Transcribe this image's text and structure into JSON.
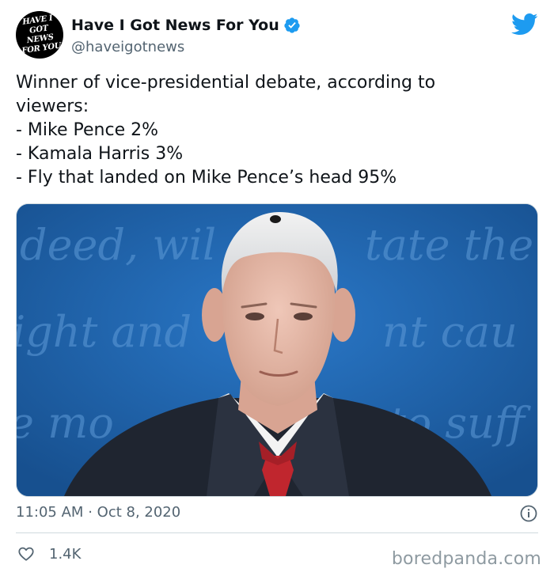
{
  "account": {
    "avatar_text_line1": "HAVE I GOT NEWS",
    "avatar_text_line2": "FOR YOU",
    "display_name": "Have I Got News For You",
    "handle": "@haveigotnews",
    "verified": true
  },
  "tweet": {
    "lines": [
      "Winner of vice-presidential debate, according to",
      "viewers:",
      "- Mike Pence 2%",
      "- Kamala Harris 3%",
      "- Fly that landed on Mike Pence’s head 95%"
    ],
    "time": "11:05 AM",
    "separator": "·",
    "date": "Oct 8, 2020",
    "likes": "1.4K"
  },
  "media": {
    "backdrop_words": [
      "deed, wil",
      "tate the",
      "ight and",
      "nt cau",
      "e mo",
      "to suff"
    ]
  },
  "watermark": "boredpanda.com",
  "colors": {
    "twitter_blue": "#1d9bf0",
    "muted_text": "#536471",
    "tie_red": "#c0262e",
    "backdrop_blue": "#1e63b0"
  },
  "icons": {
    "brand": "twitter-bird-icon",
    "verified": "verified-badge-icon",
    "info": "info-icon",
    "like": "heart-outline-icon"
  }
}
